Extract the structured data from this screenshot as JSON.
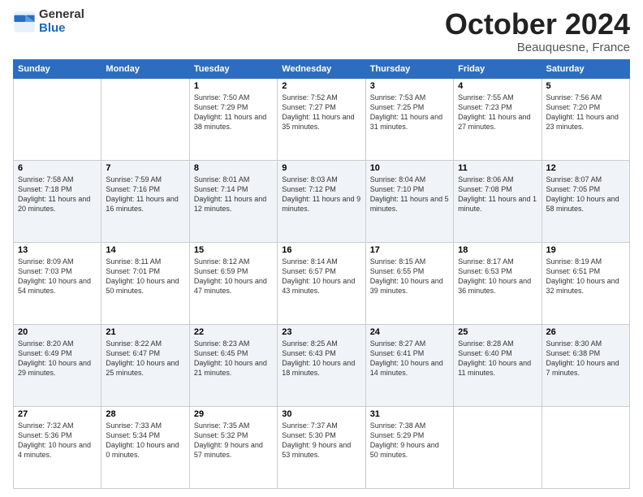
{
  "header": {
    "logo_general": "General",
    "logo_blue": "Blue",
    "month_title": "October 2024",
    "location": "Beauquesne, France"
  },
  "weekdays": [
    "Sunday",
    "Monday",
    "Tuesday",
    "Wednesday",
    "Thursday",
    "Friday",
    "Saturday"
  ],
  "weeks": [
    [
      {
        "day": "",
        "sunrise": "",
        "sunset": "",
        "daylight": ""
      },
      {
        "day": "",
        "sunrise": "",
        "sunset": "",
        "daylight": ""
      },
      {
        "day": "1",
        "sunrise": "Sunrise: 7:50 AM",
        "sunset": "Sunset: 7:29 PM",
        "daylight": "Daylight: 11 hours and 38 minutes."
      },
      {
        "day": "2",
        "sunrise": "Sunrise: 7:52 AM",
        "sunset": "Sunset: 7:27 PM",
        "daylight": "Daylight: 11 hours and 35 minutes."
      },
      {
        "day": "3",
        "sunrise": "Sunrise: 7:53 AM",
        "sunset": "Sunset: 7:25 PM",
        "daylight": "Daylight: 11 hours and 31 minutes."
      },
      {
        "day": "4",
        "sunrise": "Sunrise: 7:55 AM",
        "sunset": "Sunset: 7:23 PM",
        "daylight": "Daylight: 11 hours and 27 minutes."
      },
      {
        "day": "5",
        "sunrise": "Sunrise: 7:56 AM",
        "sunset": "Sunset: 7:20 PM",
        "daylight": "Daylight: 11 hours and 23 minutes."
      }
    ],
    [
      {
        "day": "6",
        "sunrise": "Sunrise: 7:58 AM",
        "sunset": "Sunset: 7:18 PM",
        "daylight": "Daylight: 11 hours and 20 minutes."
      },
      {
        "day": "7",
        "sunrise": "Sunrise: 7:59 AM",
        "sunset": "Sunset: 7:16 PM",
        "daylight": "Daylight: 11 hours and 16 minutes."
      },
      {
        "day": "8",
        "sunrise": "Sunrise: 8:01 AM",
        "sunset": "Sunset: 7:14 PM",
        "daylight": "Daylight: 11 hours and 12 minutes."
      },
      {
        "day": "9",
        "sunrise": "Sunrise: 8:03 AM",
        "sunset": "Sunset: 7:12 PM",
        "daylight": "Daylight: 11 hours and 9 minutes."
      },
      {
        "day": "10",
        "sunrise": "Sunrise: 8:04 AM",
        "sunset": "Sunset: 7:10 PM",
        "daylight": "Daylight: 11 hours and 5 minutes."
      },
      {
        "day": "11",
        "sunrise": "Sunrise: 8:06 AM",
        "sunset": "Sunset: 7:08 PM",
        "daylight": "Daylight: 11 hours and 1 minute."
      },
      {
        "day": "12",
        "sunrise": "Sunrise: 8:07 AM",
        "sunset": "Sunset: 7:05 PM",
        "daylight": "Daylight: 10 hours and 58 minutes."
      }
    ],
    [
      {
        "day": "13",
        "sunrise": "Sunrise: 8:09 AM",
        "sunset": "Sunset: 7:03 PM",
        "daylight": "Daylight: 10 hours and 54 minutes."
      },
      {
        "day": "14",
        "sunrise": "Sunrise: 8:11 AM",
        "sunset": "Sunset: 7:01 PM",
        "daylight": "Daylight: 10 hours and 50 minutes."
      },
      {
        "day": "15",
        "sunrise": "Sunrise: 8:12 AM",
        "sunset": "Sunset: 6:59 PM",
        "daylight": "Daylight: 10 hours and 47 minutes."
      },
      {
        "day": "16",
        "sunrise": "Sunrise: 8:14 AM",
        "sunset": "Sunset: 6:57 PM",
        "daylight": "Daylight: 10 hours and 43 minutes."
      },
      {
        "day": "17",
        "sunrise": "Sunrise: 8:15 AM",
        "sunset": "Sunset: 6:55 PM",
        "daylight": "Daylight: 10 hours and 39 minutes."
      },
      {
        "day": "18",
        "sunrise": "Sunrise: 8:17 AM",
        "sunset": "Sunset: 6:53 PM",
        "daylight": "Daylight: 10 hours and 36 minutes."
      },
      {
        "day": "19",
        "sunrise": "Sunrise: 8:19 AM",
        "sunset": "Sunset: 6:51 PM",
        "daylight": "Daylight: 10 hours and 32 minutes."
      }
    ],
    [
      {
        "day": "20",
        "sunrise": "Sunrise: 8:20 AM",
        "sunset": "Sunset: 6:49 PM",
        "daylight": "Daylight: 10 hours and 29 minutes."
      },
      {
        "day": "21",
        "sunrise": "Sunrise: 8:22 AM",
        "sunset": "Sunset: 6:47 PM",
        "daylight": "Daylight: 10 hours and 25 minutes."
      },
      {
        "day": "22",
        "sunrise": "Sunrise: 8:23 AM",
        "sunset": "Sunset: 6:45 PM",
        "daylight": "Daylight: 10 hours and 21 minutes."
      },
      {
        "day": "23",
        "sunrise": "Sunrise: 8:25 AM",
        "sunset": "Sunset: 6:43 PM",
        "daylight": "Daylight: 10 hours and 18 minutes."
      },
      {
        "day": "24",
        "sunrise": "Sunrise: 8:27 AM",
        "sunset": "Sunset: 6:41 PM",
        "daylight": "Daylight: 10 hours and 14 minutes."
      },
      {
        "day": "25",
        "sunrise": "Sunrise: 8:28 AM",
        "sunset": "Sunset: 6:40 PM",
        "daylight": "Daylight: 10 hours and 11 minutes."
      },
      {
        "day": "26",
        "sunrise": "Sunrise: 8:30 AM",
        "sunset": "Sunset: 6:38 PM",
        "daylight": "Daylight: 10 hours and 7 minutes."
      }
    ],
    [
      {
        "day": "27",
        "sunrise": "Sunrise: 7:32 AM",
        "sunset": "Sunset: 5:36 PM",
        "daylight": "Daylight: 10 hours and 4 minutes."
      },
      {
        "day": "28",
        "sunrise": "Sunrise: 7:33 AM",
        "sunset": "Sunset: 5:34 PM",
        "daylight": "Daylight: 10 hours and 0 minutes."
      },
      {
        "day": "29",
        "sunrise": "Sunrise: 7:35 AM",
        "sunset": "Sunset: 5:32 PM",
        "daylight": "Daylight: 9 hours and 57 minutes."
      },
      {
        "day": "30",
        "sunrise": "Sunrise: 7:37 AM",
        "sunset": "Sunset: 5:30 PM",
        "daylight": "Daylight: 9 hours and 53 minutes."
      },
      {
        "day": "31",
        "sunrise": "Sunrise: 7:38 AM",
        "sunset": "Sunset: 5:29 PM",
        "daylight": "Daylight: 9 hours and 50 minutes."
      },
      {
        "day": "",
        "sunrise": "",
        "sunset": "",
        "daylight": ""
      },
      {
        "day": "",
        "sunrise": "",
        "sunset": "",
        "daylight": ""
      }
    ]
  ]
}
